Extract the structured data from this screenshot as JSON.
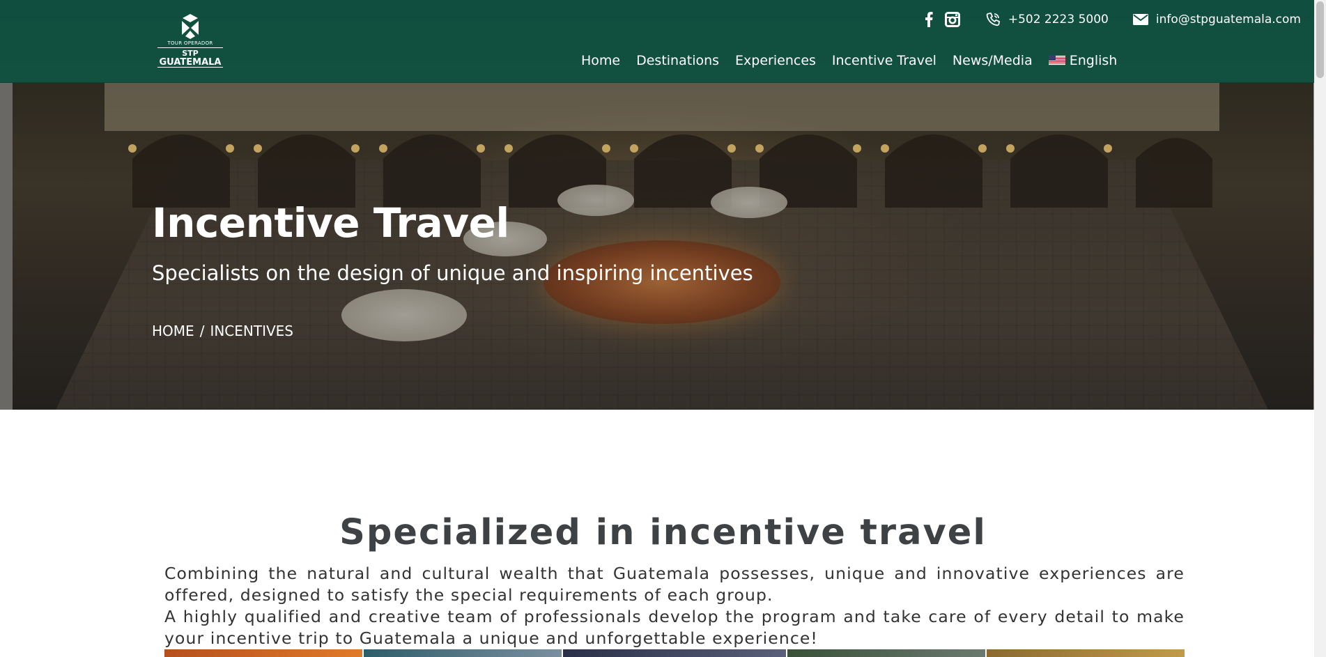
{
  "header": {
    "logo": {
      "line1": "TOUR OPERADOR",
      "line2": "STP",
      "line3": "GUATEMALA"
    },
    "topbar": {
      "facebook_icon": "facebook-icon",
      "instagram_icon": "instagram-icon",
      "phone_icon": "phone-icon",
      "phone": "+502 2223 5000",
      "mail_icon": "mail-icon",
      "email": "info@stpguatemala.com"
    },
    "nav": {
      "items": [
        "Home",
        "Destinations",
        "Experiences",
        "Incentive Travel",
        "News/Media"
      ],
      "language": "English",
      "language_flag": "us-flag-icon"
    }
  },
  "hero": {
    "title": "Incentive Travel",
    "subtitle": "Specialists on the design of unique and inspiring incentives",
    "breadcrumb": {
      "home": "HOME",
      "separator": "/",
      "current": "INCENTIVES"
    }
  },
  "content": {
    "heading": "Specialized in incentive travel",
    "paragraph1": "Combining the natural and cultural wealth that Guatemala possesses, unique and innovative experiences are offered, designed to satisfy the special requirements of each group.",
    "paragraph2": "A highly qualified and creative team of professionals develop the program and take care of every detail to make your incentive trip to Guatemala a unique and unforgettable experience!"
  },
  "colors": {
    "header_bg": "#105442",
    "heading_text": "#3f4244",
    "body_text": "#333333"
  }
}
